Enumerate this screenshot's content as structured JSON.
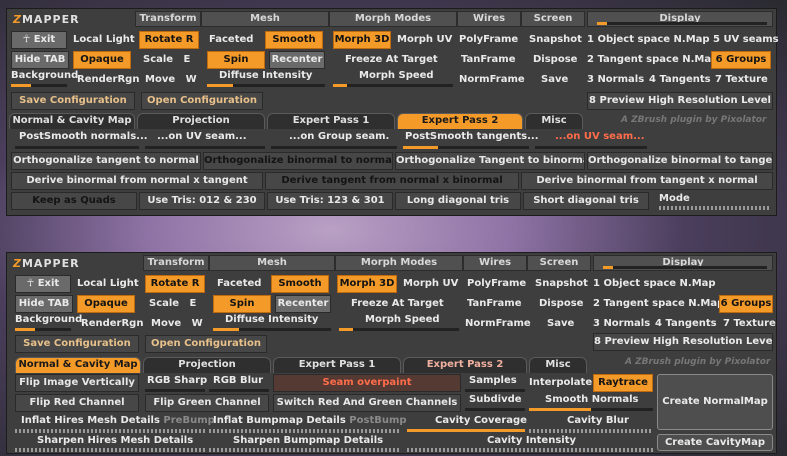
{
  "logo": {
    "z": "Z",
    "rest": "MAPPER"
  },
  "headers": {
    "transform": "Transform",
    "mesh": "Mesh",
    "morph_modes": "Morph Modes",
    "wires": "Wires",
    "screen": "Screen",
    "display": "Display"
  },
  "left": {
    "exit": "Exit",
    "local_light": "Local Light",
    "hide_tab": "Hide TAB",
    "opaque": "Opaque",
    "background": "Background",
    "render_rgn": "RenderRgn"
  },
  "transform": {
    "rotate": "Rotate",
    "rotate_key": "R",
    "scale": "Scale",
    "scale_key": "E",
    "move": "Move",
    "move_key": "W"
  },
  "mesh": {
    "faceted": "Faceted",
    "smooth": "Smooth",
    "spin": "Spin",
    "recenter": "Recenter",
    "diffuse_intensity": "Diffuse Intensity"
  },
  "morph": {
    "morph3d": "Morph 3D",
    "morph_uv": "Morph UV",
    "freeze": "Freeze At Target",
    "speed": "Morph Speed"
  },
  "wires": {
    "polyframe": "PolyFrame",
    "tanframe": "TanFrame",
    "normframe": "NormFrame"
  },
  "screen": {
    "snapshot": "Snapshot",
    "dispose": "Dispose",
    "save": "Save"
  },
  "display": {
    "opt1": "1 Object space N.Map",
    "opt5": "5 UV seams",
    "opt2": "2 Tangent space N.Map",
    "opt6": "6 Groups",
    "opt3": "3 Normals",
    "opt4": "4 Tangents",
    "opt7": "7 Texture",
    "opt8": "8 Preview High Resolution Level"
  },
  "config": {
    "save": "Save Configuration",
    "open": "Open Configuration"
  },
  "tabs": {
    "normal_cavity": "Normal & Cavity Map",
    "projection": "Projection",
    "pass1": "Expert Pass 1",
    "pass2": "Expert Pass 2",
    "misc": "Misc"
  },
  "credit": "A ZBrush plugin by Pixolator",
  "pass2": {
    "postsmooth_normals": "PostSmooth normals...",
    "on_uv": "...on UV seam...",
    "on_group": "...on Group seam.",
    "postsmooth_tangents": "PostSmooth tangents...",
    "on_uv_red": "...on UV seam...",
    "orth1": "Orthogonalize  tangent to normal",
    "orth2": "Orthogonalize  binormal to normal",
    "orth3": "Orthogonalize Tangent to binormal",
    "orth4": "Orthogonalize binormal to tangent",
    "derive1": "Derive binormal from normal x tangent",
    "derive2": "Derive tangent from normal x binormal",
    "derive3": "Derive binormal from tangent x normal",
    "keep_quads": "Keep as Quads",
    "use_tris1": "Use Tris: 012 & 230",
    "use_tris2": "Use Tris: 123 & 301",
    "long_diag": "Long diagonal tris",
    "short_diag": "Short diagonal tris",
    "mode": "Mode"
  },
  "ncmap": {
    "flip_v": "Flip Image Vertically",
    "rgb_sharp": "RGB Sharp",
    "rgb_blur": "RGB Blur",
    "seam_overpaint": "Seam overpaint",
    "samples": "Samples",
    "interpolate": "Interpolate",
    "raytrace": "Raytrace",
    "flip_red": "Flip Red Channel",
    "flip_green": "Flip Green Channel",
    "switch_rg": "Switch Red And Green Channels",
    "subdivide": "Subdivde",
    "smooth_normals": "Smooth Normals",
    "create_normalmap": "Create NormalMap",
    "inflat_hires": "Inflat Hires Mesh Details",
    "prebump": "PreBump",
    "inflat_bump": "Inflat Bumpmap Details",
    "postbump": "PostBump",
    "cavity_coverage": "Cavity Coverage",
    "cavity_blur": "Cavity Blur",
    "sharpen_hires": "Sharpen Hires Mesh Details",
    "sharpen_bump": "Sharpen Bumpmap Details",
    "cavity_intensity": "Cavity Intensity",
    "create_cavitymap": "Create CavityMap"
  },
  "colors": {
    "accent": "#f49a28",
    "panel": "#3e3e3e",
    "button": "#474747"
  }
}
